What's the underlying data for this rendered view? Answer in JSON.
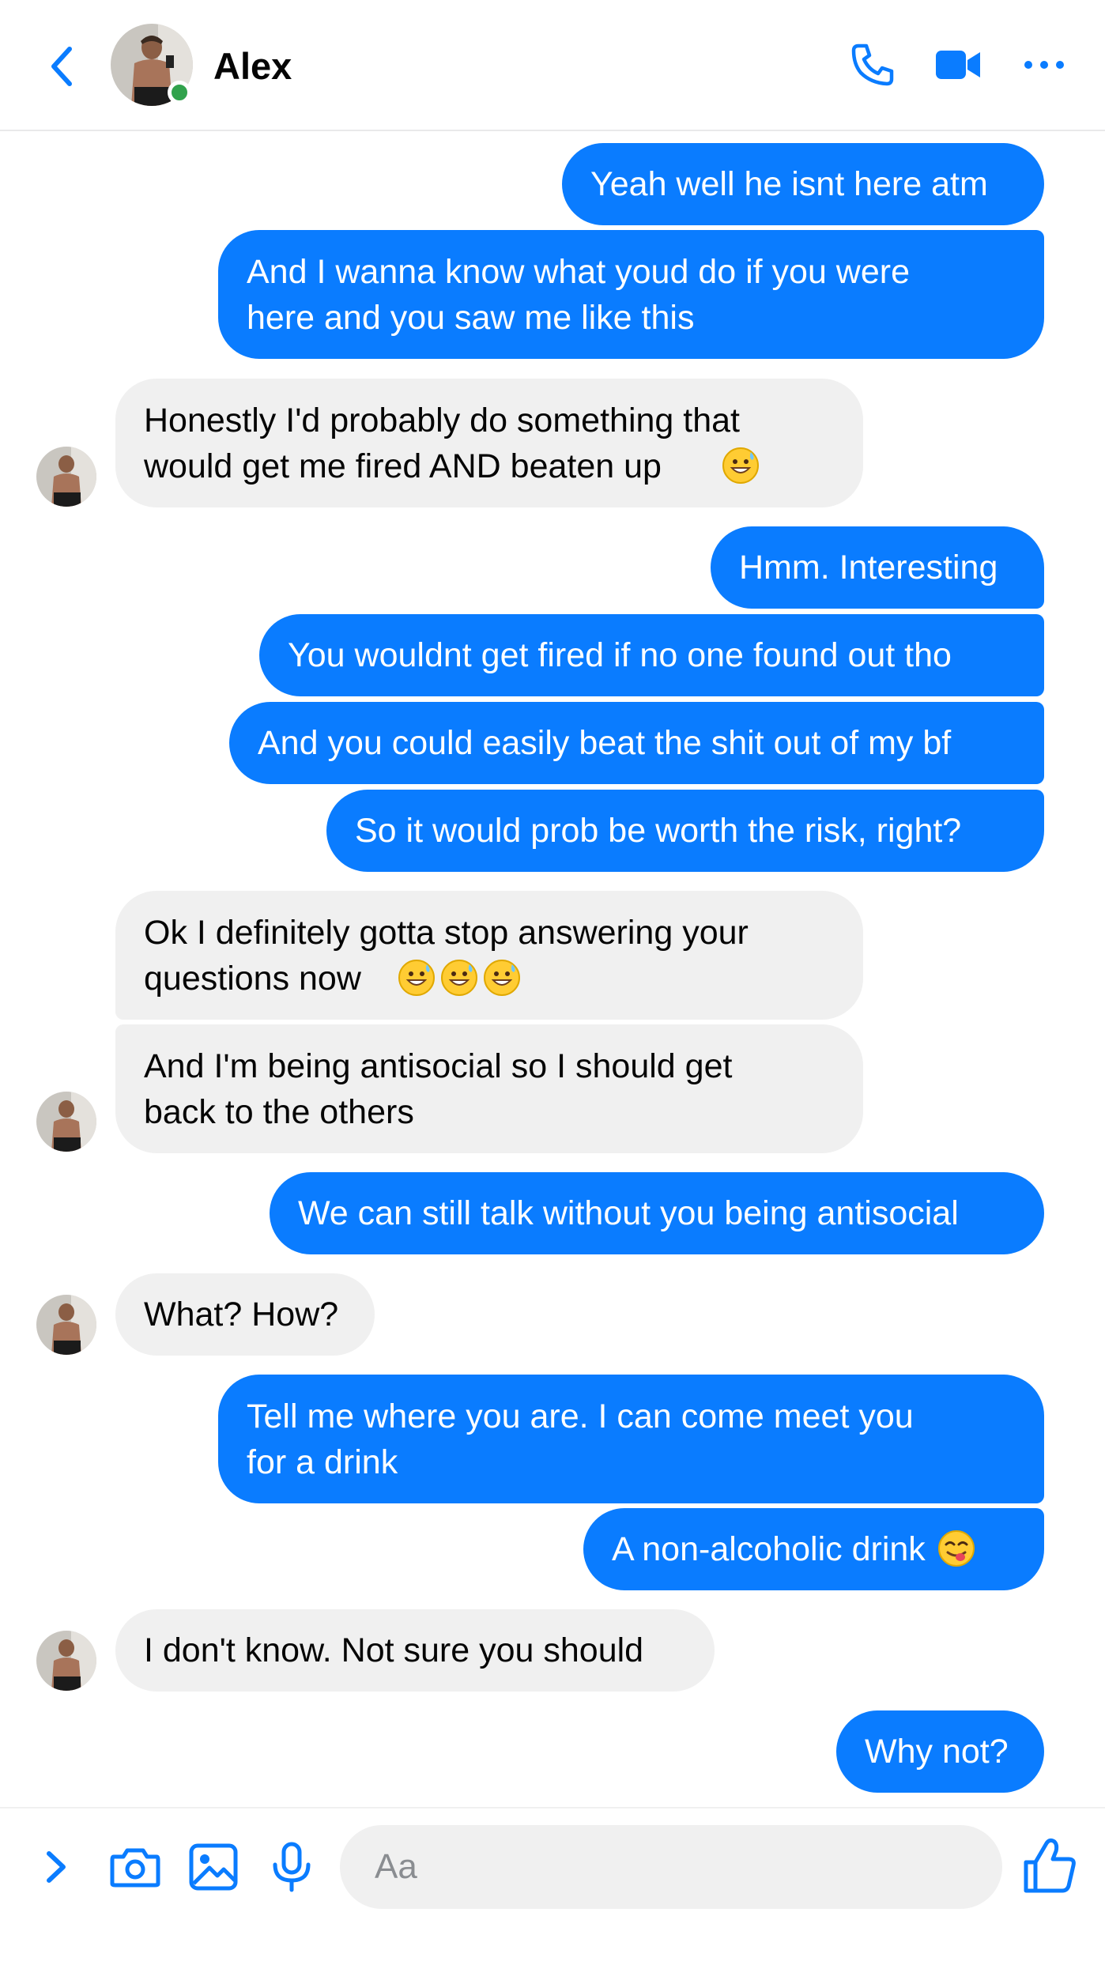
{
  "header": {
    "contact_name": "Alex",
    "online_status_color": "#31a24c",
    "icons": [
      "back-chevron-icon",
      "phone-icon",
      "video-camera-icon",
      "more-options-icon"
    ]
  },
  "colors": {
    "accent": "#0a7cff",
    "incoming_bubble": "#f0f0f0",
    "outgoing_text": "#ffffff"
  },
  "messages": [
    {
      "from": "me",
      "text": "Yeah well he isnt here atm"
    },
    {
      "from": "me",
      "text": "And I wanna know what youd do if you were\nhere and you saw me like this"
    },
    {
      "from": "Alex",
      "text": "Honestly I'd probably do something that\nwould get me fired AND beaten up",
      "emoji": [
        "grinning-face-with-sweat"
      ]
    },
    {
      "from": "me",
      "text": "Hmm. Interesting"
    },
    {
      "from": "me",
      "text": "You wouldnt get fired if no one found out tho"
    },
    {
      "from": "me",
      "text": "And you could easily beat the shit out of my bf"
    },
    {
      "from": "me",
      "text": "So it would prob be worth the risk, right?"
    },
    {
      "from": "Alex",
      "text": "Ok I definitely gotta stop answering your\nquestions now",
      "emoji": [
        "grinning-face-with-sweat",
        "grinning-face-with-sweat",
        "grinning-face-with-sweat"
      ]
    },
    {
      "from": "Alex",
      "text": "And I'm being antisocial so I should get\nback to the others"
    },
    {
      "from": "me",
      "text": "We can still talk without you being antisocial"
    },
    {
      "from": "Alex",
      "text": "What? How?"
    },
    {
      "from": "me",
      "text": "Tell me where you are. I can come meet you\nfor a drink"
    },
    {
      "from": "me",
      "text": "A non-alcoholic drink",
      "emoji": [
        "face-savoring-food"
      ]
    },
    {
      "from": "Alex",
      "text": "I don't know. Not sure you should"
    },
    {
      "from": "me",
      "text": "Why not?"
    }
  ],
  "composer": {
    "placeholder": "Aa",
    "icons": [
      "expand-chevron-icon",
      "camera-icon",
      "gallery-icon",
      "microphone-icon",
      "thumbs-up-icon"
    ]
  }
}
